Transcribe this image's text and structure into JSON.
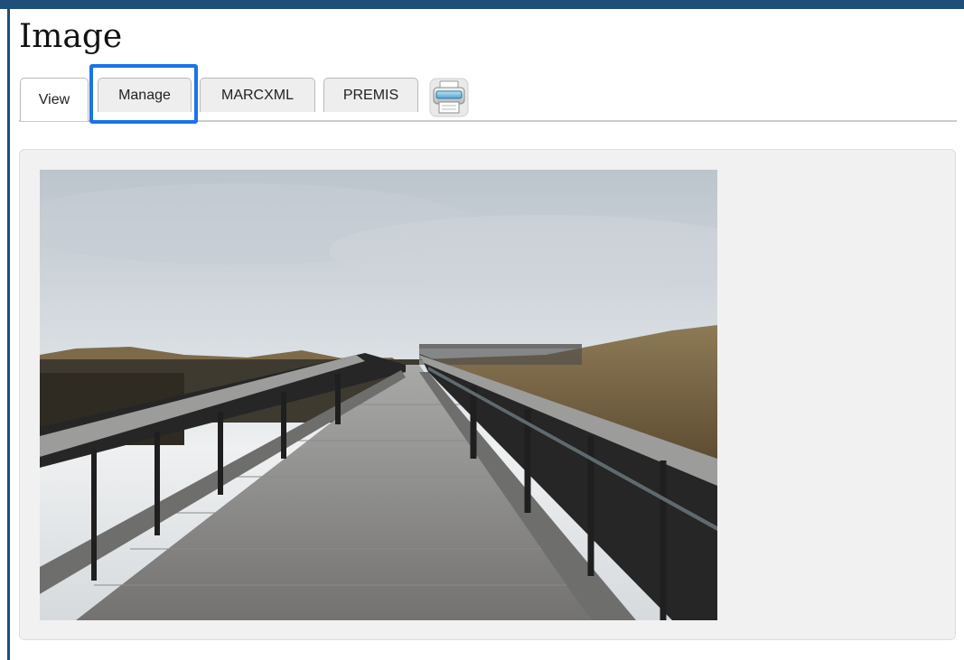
{
  "page": {
    "title": "Image"
  },
  "tabs": [
    {
      "label": "View",
      "active": true
    },
    {
      "label": "Manage",
      "active": false,
      "highlighted": true
    },
    {
      "label": "MARCXML",
      "active": false
    },
    {
      "label": "PREMIS",
      "active": false
    }
  ],
  "toolbar": {
    "print_icon": "printer-icon"
  },
  "colors": {
    "frame": "#1f4e79",
    "highlight": "#1a73e8",
    "panel": "#f1f1f1"
  },
  "content": {
    "image_subject": "wooden boardwalk through dunes under overcast sky"
  }
}
